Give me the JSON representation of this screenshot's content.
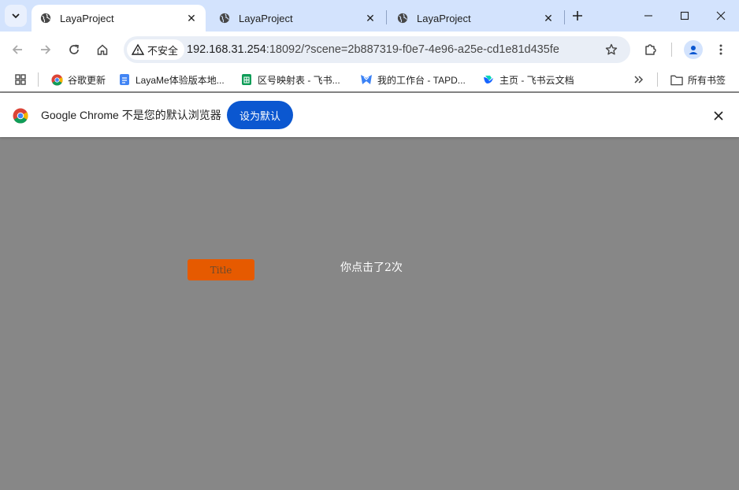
{
  "tabs": [
    {
      "title": "LayaProject",
      "active": true
    },
    {
      "title": "LayaProject",
      "active": false
    },
    {
      "title": "LayaProject",
      "active": false
    }
  ],
  "addressbar": {
    "security_label": "不安全",
    "url_host": "192.168.31.254",
    "url_rest": ":18092/?scene=2b887319-f0e7-4e96-a25e-cd1e81d435fe"
  },
  "bookmarks": {
    "items": [
      {
        "label": "谷歌更新"
      },
      {
        "label": "LayaMe体验版本地..."
      },
      {
        "label": "区号映射表 - 飞书..."
      },
      {
        "label": "我的工作台 - TAPD..."
      },
      {
        "label": "主页 - 飞书云文档"
      }
    ],
    "all_bookmarks": "所有书签"
  },
  "infobar": {
    "message": "Google Chrome 不是您的默认浏览器",
    "button_label": "设为默认"
  },
  "page": {
    "button_label": "Title",
    "click_text": "你点击了2次"
  },
  "colors": {
    "tabstrip": "#d3e3fd",
    "accent_button": "#0b57d0",
    "page_background": "#878787",
    "game_button": "#e65a00"
  }
}
